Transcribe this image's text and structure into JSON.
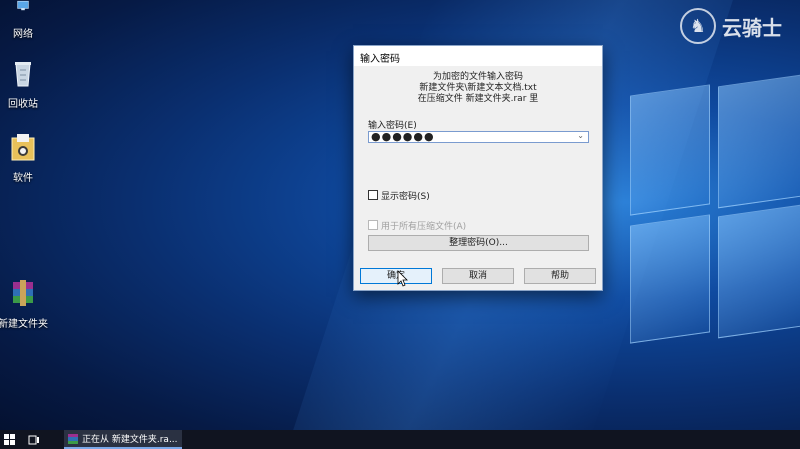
{
  "desktop": {
    "icons": [
      {
        "label": "网络"
      },
      {
        "label": "回收站"
      },
      {
        "label": "软件"
      },
      {
        "label": "新建文件夹"
      }
    ]
  },
  "watermark": {
    "text": "云骑士"
  },
  "dialog": {
    "title": "输入密码",
    "info_line1": "为加密的文件输入密码",
    "info_line2": "新建文件夹\\新建文本文档.txt",
    "info_line3": "在压缩文件 新建文件夹.rar 里",
    "password_label": "输入密码(E)",
    "password_value": "●●●●●●",
    "show_password_label": "显示密码(S)",
    "use_all_label": "用于所有压缩文件(A)",
    "organize_button": "整理密码(O)...",
    "ok_button": "确定",
    "cancel_button": "取消",
    "help_button": "帮助"
  },
  "taskbar": {
    "task_label": "正在从 新建文件夹.ra..."
  },
  "colors": {
    "accent": "#0078d7",
    "taskbar": "#101420"
  }
}
